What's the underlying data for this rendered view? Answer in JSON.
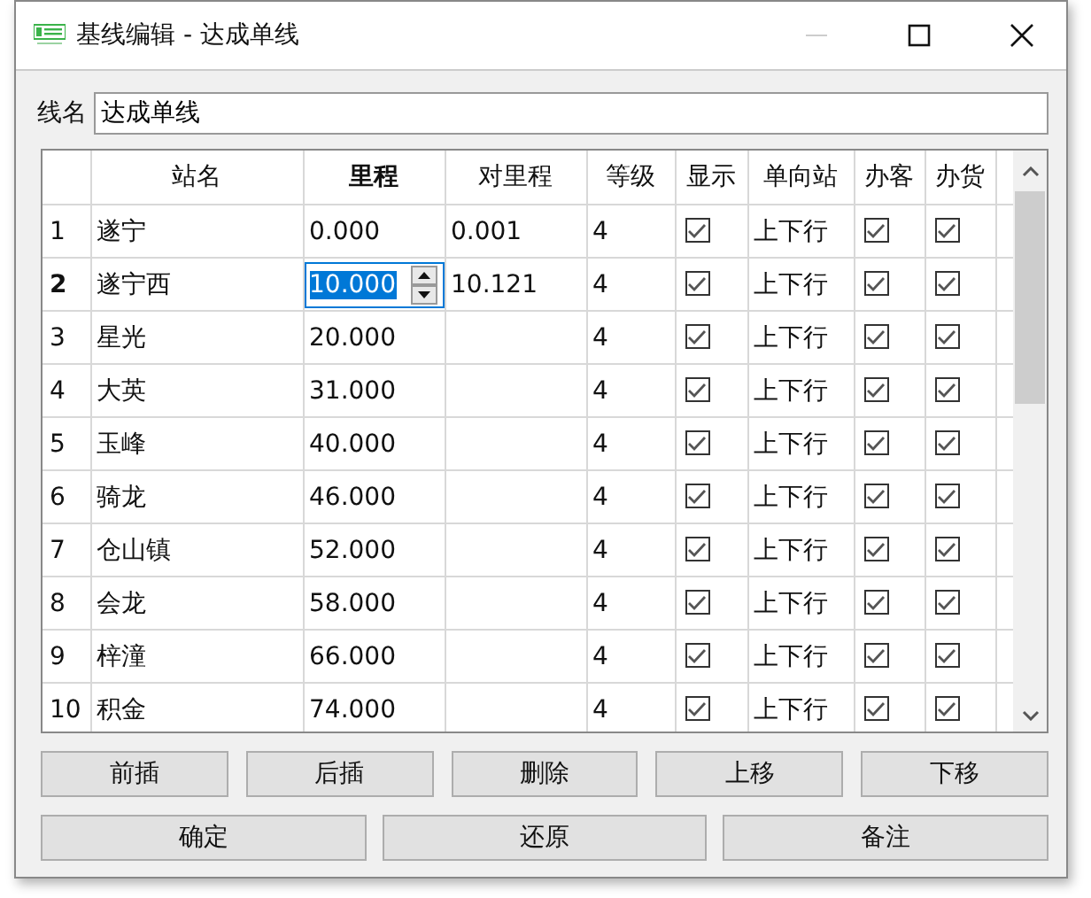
{
  "window": {
    "title": "基线编辑 - 达成单线"
  },
  "line_name": {
    "label": "线名",
    "value": "达成单线"
  },
  "table": {
    "columns": [
      "站名",
      "里程",
      "对里程",
      "等级",
      "显示",
      "单向站",
      "办客",
      "办货"
    ],
    "rows": [
      {
        "index": "1",
        "selected": false,
        "name": "遂宁",
        "mileage": "0.000",
        "counter_mileage": "0.001",
        "level": "4",
        "show": true,
        "direction": "上下行",
        "passenger": true,
        "freight": true
      },
      {
        "index": "2",
        "selected": true,
        "name": "遂宁西",
        "mileage": "10.000",
        "counter_mileage": "10.121",
        "level": "4",
        "show": true,
        "direction": "上下行",
        "passenger": true,
        "freight": true
      },
      {
        "index": "3",
        "selected": false,
        "name": "星光",
        "mileage": "20.000",
        "level": "4",
        "show": true,
        "direction": "上下行",
        "passenger": true,
        "freight": true
      },
      {
        "index": "4",
        "selected": false,
        "name": "大英",
        "mileage": "31.000",
        "level": "4",
        "show": true,
        "direction": "上下行",
        "passenger": true,
        "freight": true
      },
      {
        "index": "5",
        "selected": false,
        "name": "玉峰",
        "mileage": "40.000",
        "level": "4",
        "show": true,
        "direction": "上下行",
        "passenger": true,
        "freight": true
      },
      {
        "index": "6",
        "selected": false,
        "name": "骑龙",
        "mileage": "46.000",
        "level": "4",
        "show": true,
        "direction": "上下行",
        "passenger": true,
        "freight": true
      },
      {
        "index": "7",
        "selected": false,
        "name": "仓山镇",
        "mileage": "52.000",
        "level": "4",
        "show": true,
        "direction": "上下行",
        "passenger": true,
        "freight": true
      },
      {
        "index": "8",
        "selected": false,
        "name": "会龙",
        "mileage": "58.000",
        "level": "4",
        "show": true,
        "direction": "上下行",
        "passenger": true,
        "freight": true
      },
      {
        "index": "9",
        "selected": false,
        "name": "梓潼",
        "mileage": "66.000",
        "level": "4",
        "show": true,
        "direction": "上下行",
        "passenger": true,
        "freight": true
      },
      {
        "index": "10",
        "selected": false,
        "name": "积金",
        "mileage": "74.000",
        "level": "4",
        "show": true,
        "direction": "上下行",
        "passenger": true,
        "freight": true
      }
    ]
  },
  "buttons_row_1": [
    "前插",
    "后插",
    "删除",
    "上移",
    "下移"
  ],
  "buttons_row_2": [
    "确定",
    "还原",
    "备注"
  ]
}
